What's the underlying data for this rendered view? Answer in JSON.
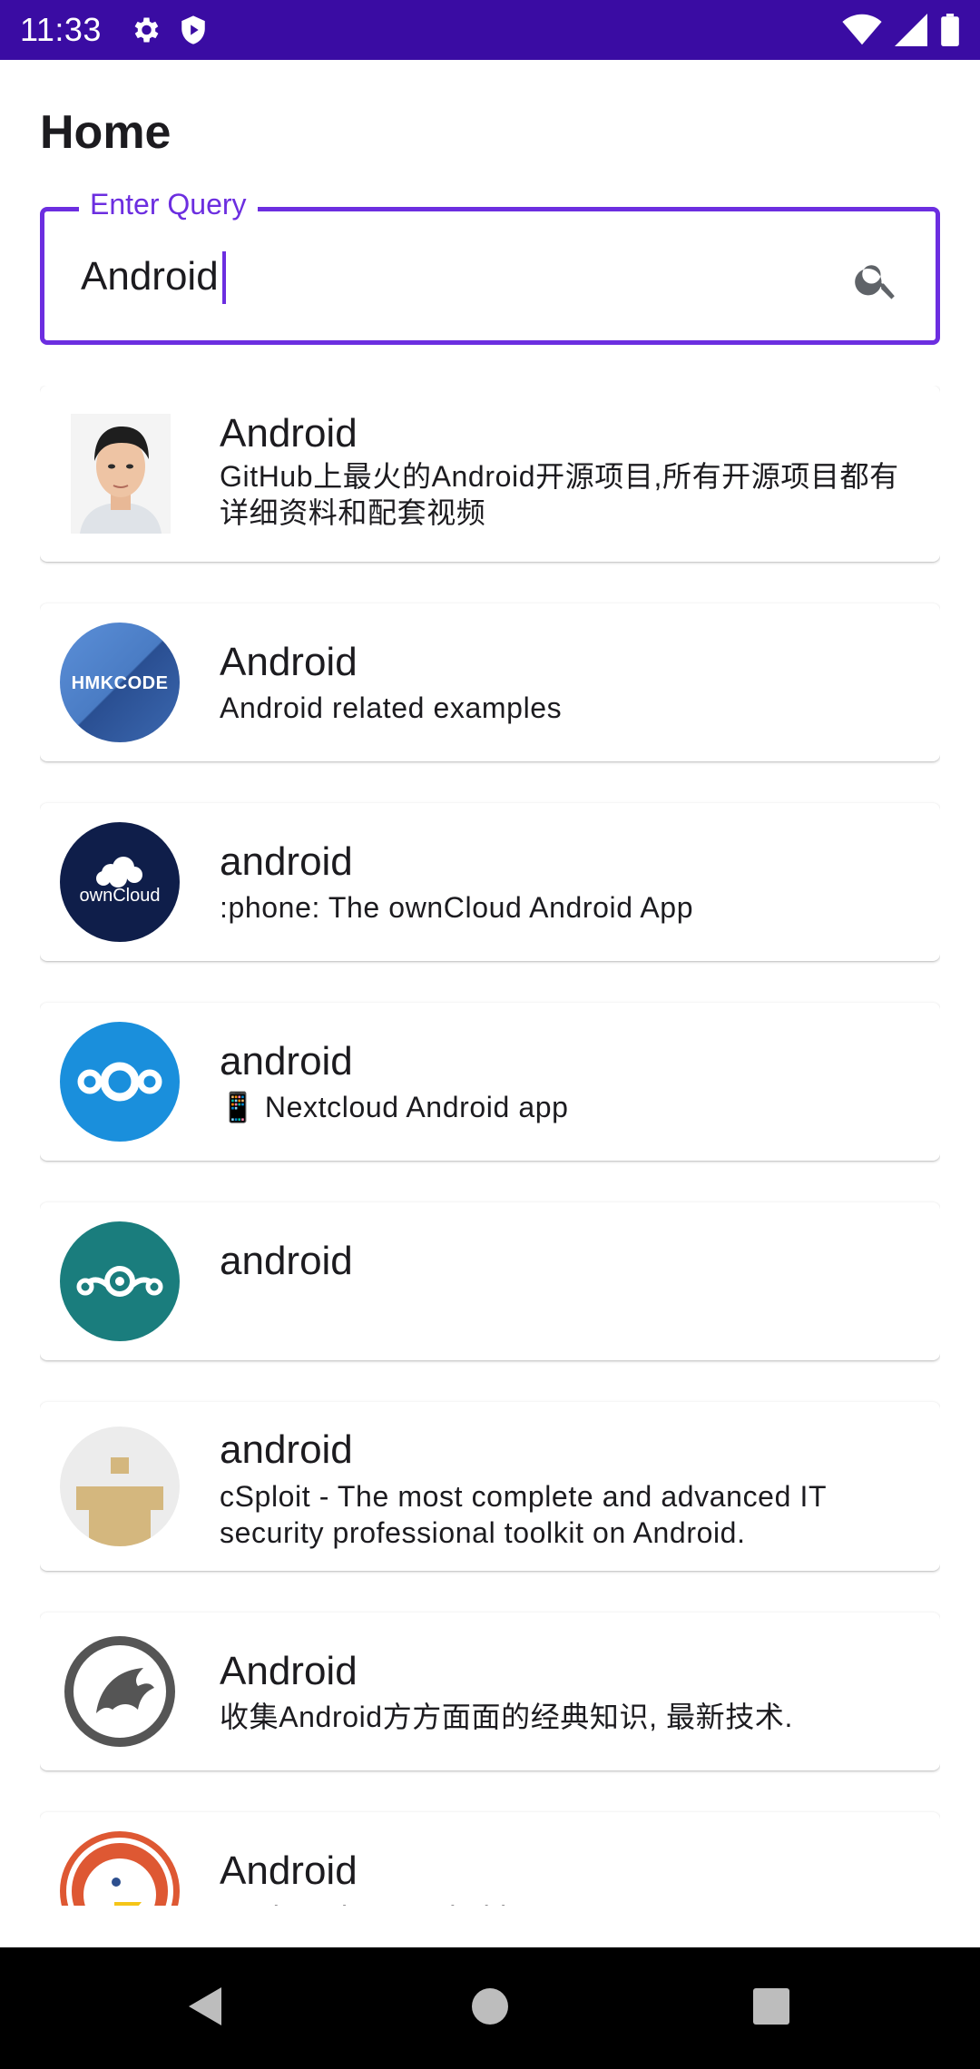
{
  "status_bar": {
    "time": "11:33"
  },
  "header": {
    "title": "Home"
  },
  "search": {
    "label": "Enter Query",
    "value": "Android"
  },
  "results": [
    {
      "title": "Android",
      "description": "GitHub上最火的Android开源项目,所有开源项目都有详细资料和配套视频",
      "avatar": "person-photo"
    },
    {
      "title": "Android",
      "description": "Android related examples",
      "avatar": "hmkcode-logo",
      "avatar_text": "HMKCODE"
    },
    {
      "title": "android",
      "description": ":phone: The ownCloud Android App",
      "avatar": "owncloud-logo",
      "avatar_text": "ownCloud"
    },
    {
      "title": "android",
      "description": "📱 Nextcloud Android app",
      "avatar": "nextcloud-logo"
    },
    {
      "title": "android",
      "description": "",
      "avatar": "lineageos-logo"
    },
    {
      "title": "android",
      "description": "cSploit - The most complete and advanced IT security professional toolkit on Android.",
      "avatar": "csploit-logo"
    },
    {
      "title": "Android",
      "description": "收集Android方方面面的经典知识, 最新技术.",
      "avatar": "dragon-logo"
    },
    {
      "title": "Android",
      "description": "DuckDuckGo Android App",
      "avatar": "duckduckgo-logo"
    }
  ],
  "colors": {
    "status_bar": "#3a0ca3",
    "accent": "#6c2ee0"
  }
}
